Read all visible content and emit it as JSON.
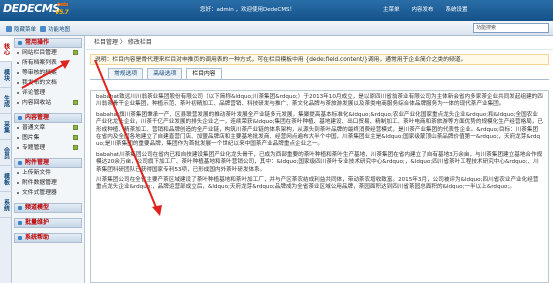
{
  "header": {
    "logo": "DEDECMS",
    "logo_beta": "beta",
    "logo_version": "V5.7",
    "user_info": "您好：admin ，欢迎使用DedeCMS！",
    "nav": [
      "主菜单",
      "内容发布",
      "系统设置"
    ]
  },
  "subbar": {
    "hide_menu": "隐藏菜单",
    "func_map": "功能地图",
    "search_value": "功能搜索"
  },
  "sidetabs": [
    "核心",
    "模块",
    "生成",
    "采集",
    "会员",
    "模板",
    "系统"
  ],
  "menu": {
    "sections": [
      {
        "title": "常用操作",
        "items": [
          {
            "label": "网站栏目管理",
            "tag": true
          },
          {
            "label": "所有档案列表",
            "tag": false
          },
          {
            "label": "等审核的档案",
            "tag": false
          },
          {
            "label": "我发布的文档",
            "tag": false
          },
          {
            "label": "评论管理",
            "tag": false
          },
          {
            "label": "内容回收站",
            "tag": true
          }
        ]
      },
      {
        "title": "内容管理",
        "items": [
          {
            "label": "普通文章",
            "tag": true
          },
          {
            "label": "图片集",
            "tag": true
          },
          {
            "label": "专题管理",
            "tag": true
          }
        ]
      },
      {
        "title": "附件管理",
        "items": [
          {
            "label": "上传新文件",
            "tag": false
          },
          {
            "label": "附件数据管理",
            "tag": false
          },
          {
            "label": "文件式管理器",
            "tag": false
          }
        ]
      },
      {
        "title": "频道模型",
        "items": []
      },
      {
        "title": "批量维护",
        "items": []
      },
      {
        "title": "系统帮助",
        "items": []
      }
    ]
  },
  "main": {
    "breadcrumb": "栏目管理 〉 修改栏目",
    "tip": "说明：栏目内容是骨代理来栏目对申推页的调用表的一种方式，可在栏目模板中用 {dede:field.content/}调用，通常用于企业简介之类的频道。",
    "tabs": [
      "常规选项",
      "高级选项",
      "栏目内容"
    ],
    "paragraphs": [
      "babahat致远川川翁茶业集团股份有限公司（以下简称&ldquo;川茶集团&rdquo;）于2013年10月成立，是以原四川省翁茶业有限公司为主体新会省内多家茶企业共同发起组建的四川翁茶骨干企业集团，种植示范、茶叶初精加工、品牌营销、科技研发与推广、茶文化品牌与茶旅游发展以及茶类电商服务综合体品牌服务为一体的现代茶产业集团。",
      "babahat旗川茶集团秉承一产、区县联营发展的推动茶叶发展全产业链多元发展，集聚提高基本标准化&ldquo;&rdquo;农业产业化国家重点龙头企业&rdquo;和&ldquo;全国农业产业化龙头企业，川茶千亿产业发展的排头企业之一，连续荣获&ldquo;集团在茶叶种植、基地建设、出口贸易、精制加工、茶叶电商和茶旅游等方面优势的规模化生产经营格局，已形成种植、精茶加工、营销和品牌创造的全产业链，构筑川茶产业链的体系架构，从源头到茶叶品牌的最终消费经营模式，是川茶产业集团的代表性企业。&rdquo;目标：川茶集团在省内及全国各地建立了自建直营门店、加盟品牌店和主要基地批发商、经营网点遍布大半个中国，川茶集团业主是&ldquo;国家级蒙顶山茶品牌价值第一&rdquo;，天府龙芽&rdquo;是川茶集团的重要品牌，集团作为首批发展一个世纪以来中国茶产业品牌重点企业之一。",
      "babahat川茶集团公司在省内已和自技建设集团产业化龙头骨干，已成为西部重要的茶叶种植和茶叶生产基地，川茶集团在省内建立了自有基地3万余亩，与川茶集团建立基地合作规模达20余万亩，公司旗下加工厂、茶叶种植基地和茶叶营销公司，其中：&ldquo;国家级四川茶叶专业技术研究中心&rdquo;，&ldquo;四川省茶叶工程技术研究中心&rdquo;、川茶集团科研团队已获得国家专利53项，已形成国内外茶叶研发体系。",
      "川茶集团公司在全省主要产茶区域建设了茶叶种植基地和茶叶加工厂，并与产区茶农结成利益共同体，带动茶农增收致富。2015年3月，公司被评为&ldquo;四川省农业产业化经营重点龙头企业&rdquo;，品牌运营部成立后，&ldquo;天府龙芽&rdquo;品牌成为全省茶业区域公用品牌，茶园面积达到四川省茶园总面积的&ldquo;一半以上&rdquo;。"
    ]
  }
}
